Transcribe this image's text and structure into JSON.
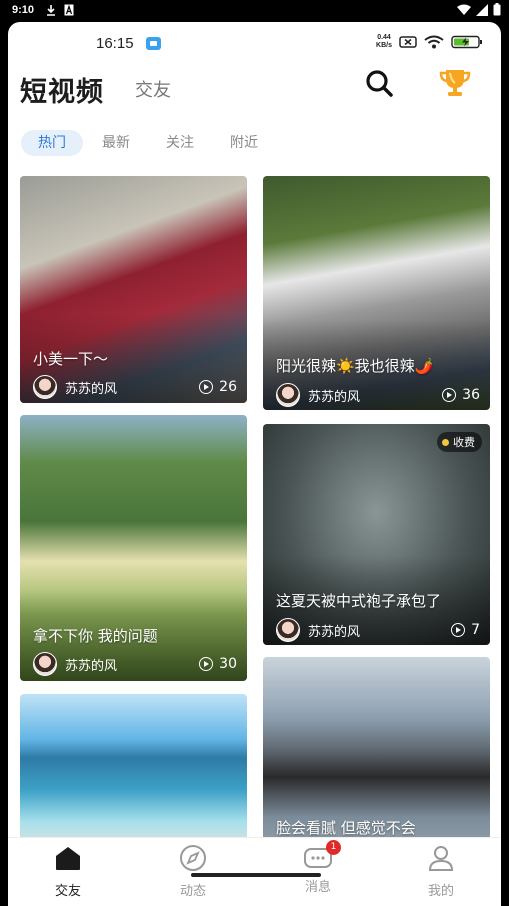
{
  "system_status": {
    "time": "9:10"
  },
  "inner_status": {
    "time": "16:15",
    "speed_value": "0.44",
    "speed_unit": "KB/s"
  },
  "header": {
    "title": "短视频",
    "secondary_tab": "交友"
  },
  "subtabs": [
    "热门",
    "最新",
    "关注",
    "附近"
  ],
  "feed": [
    {
      "caption": "小美一下～",
      "author": "苏苏的风",
      "views": "26"
    },
    {
      "caption": "阳光很辣☀️我也很辣🌶️",
      "author": "苏苏的风",
      "views": "36"
    },
    {
      "caption": "拿不下你 我的问题",
      "author": "苏苏的风",
      "views": "30"
    },
    {
      "caption": "这夏天被中式袍子承包了",
      "author": "苏苏的风",
      "views": "7",
      "badge": "收费"
    },
    {
      "caption": "",
      "author": "",
      "views": ""
    },
    {
      "caption": "脸会看腻 但感觉不会",
      "author": "",
      "views": ""
    }
  ],
  "nav": {
    "items": [
      {
        "label": "交友",
        "icon": "home-icon"
      },
      {
        "label": "动态",
        "icon": "compass-icon"
      },
      {
        "label": "消息",
        "icon": "message-icon",
        "badge": "1"
      },
      {
        "label": "我的",
        "icon": "profile-icon"
      }
    ]
  }
}
